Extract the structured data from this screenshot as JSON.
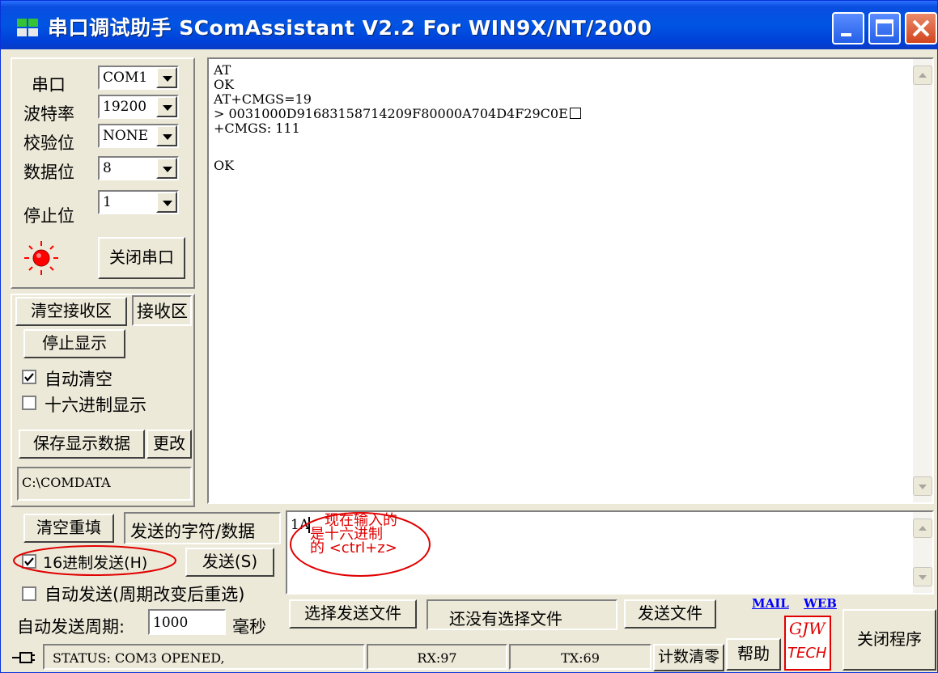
{
  "window": {
    "title": "串口调试助手 SComAssistant V2.2 For WIN9X/NT/2000"
  },
  "port_settings": {
    "rows": [
      {
        "label": "串口",
        "value": "COM1"
      },
      {
        "label": "波特率",
        "value": "19200"
      },
      {
        "label": "校验位",
        "value": "NONE"
      },
      {
        "label": "数据位",
        "value": "8"
      },
      {
        "label": "停止位",
        "value": "1"
      }
    ],
    "close_port_button": "关闭串口"
  },
  "receive_controls": {
    "clear_receive_button": "清空接收区",
    "receive_area_label": "接收区",
    "stop_display_button": "停止显示",
    "auto_clear_label": "自动清空",
    "auto_clear_checked": true,
    "hex_display_label": "十六进制显示",
    "hex_display_checked": false,
    "save_data_button": "保存显示数据",
    "change_button": "更改",
    "save_path": "C:\\COMDATA"
  },
  "receive_area": {
    "lines": [
      "AT",
      "OK",
      "AT+CMGS=19",
      "> 0031000D91683158714209F80000A704D4F29C0E",
      "+CMGS: 111",
      "",
      "OK"
    ]
  },
  "send_controls": {
    "clear_refill_button": "清空重填",
    "send_data_label": "发送的字符/数据",
    "hex_send_label": "16进制发送(H)",
    "hex_send_checked": true,
    "send_button": "发送(S)",
    "auto_send_label": "自动发送(周期改变后重选)",
    "auto_send_checked": false,
    "period_label": "自动发送周期:",
    "period_value": "1000",
    "period_unit": "毫秒"
  },
  "send_area": {
    "text": "1A"
  },
  "annotation": {
    "lines": [
      "现在输入的",
      "是十六进制",
      "的 <ctrl+z>"
    ]
  },
  "file_controls": {
    "choose_file_button": "选择发送文件",
    "no_file_label": "还没有选择文件",
    "send_file_button": "发送文件"
  },
  "links": {
    "mail": "MAIL",
    "web": "WEB"
  },
  "logo": {
    "line1": "GJW",
    "line2": "TECH"
  },
  "close_program_button": "关闭程序",
  "help_button": "帮助",
  "statusbar": {
    "status": "STATUS: COM3 OPENED,",
    "rx": "RX:97",
    "tx": "TX:69",
    "reset_counter": "计数清零"
  },
  "colors": {
    "titlebar": "#0054e3",
    "led": "#ff0000",
    "annotation": "#e00000",
    "link": "#0000ff"
  }
}
